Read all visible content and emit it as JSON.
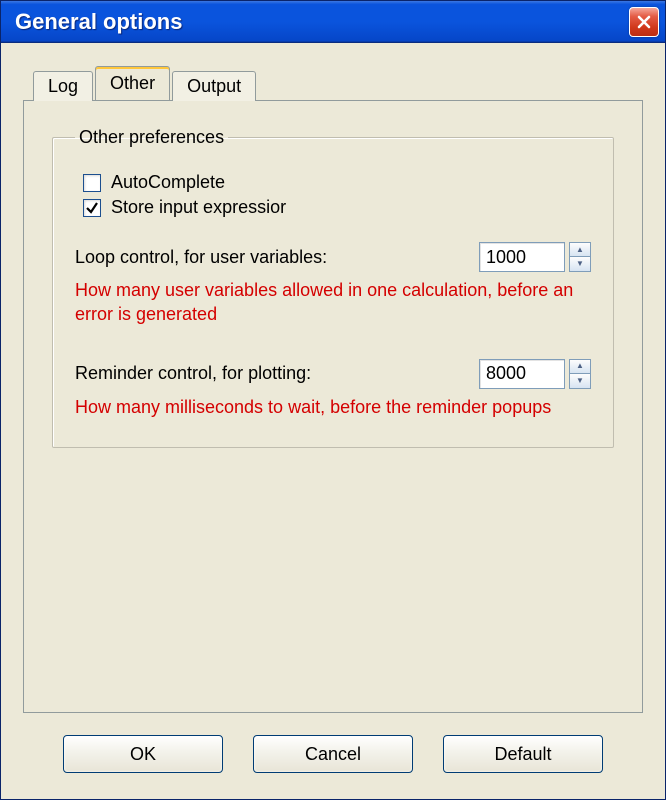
{
  "window": {
    "title": "General options"
  },
  "tabs": {
    "log": "Log",
    "other": "Other",
    "output": "Output",
    "selected_index": 1
  },
  "group": {
    "legend": "Other preferences",
    "autocomplete": {
      "label": "AutoComplete",
      "checked": false
    },
    "store": {
      "label": "Store input expressior",
      "checked": true
    },
    "loop": {
      "label": "Loop control, for user variables:",
      "value": "1000",
      "hint": "How many user variables allowed in one calculation, before an error is generated"
    },
    "reminder": {
      "label": "Reminder control, for plotting:",
      "value": "8000",
      "hint": "How many milliseconds to wait, before the reminder popups"
    }
  },
  "buttons": {
    "ok": "OK",
    "cancel": "Cancel",
    "default": "Default"
  }
}
